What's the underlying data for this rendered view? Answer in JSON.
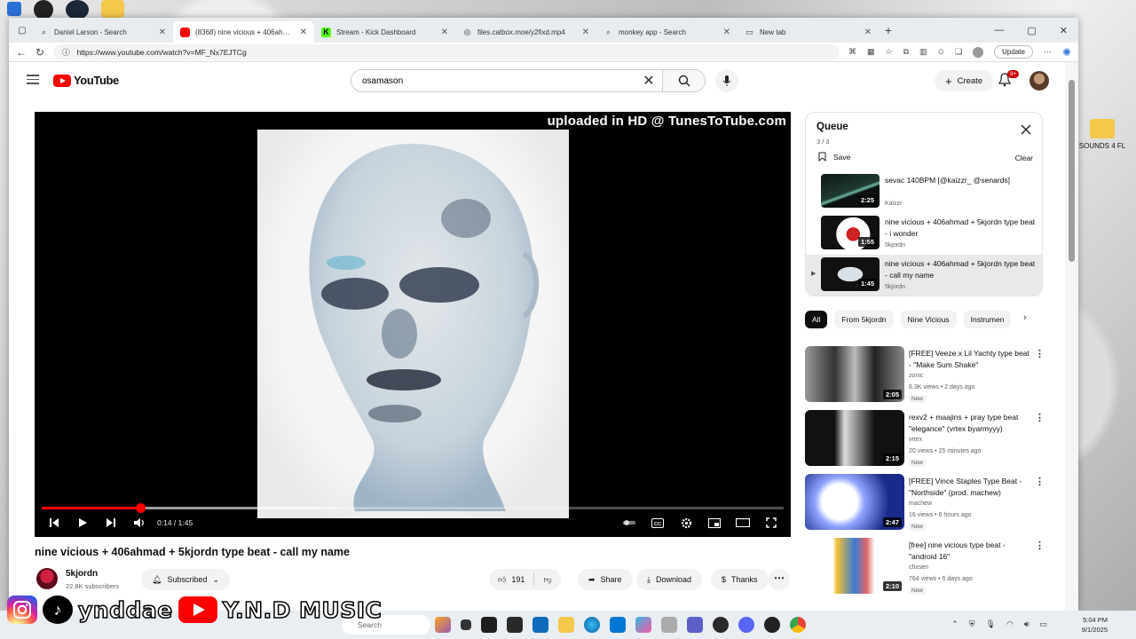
{
  "desktop": {
    "folder_label": "SOUNDS 4 FL"
  },
  "browser": {
    "tabs": [
      {
        "label": "Daniel Larson - Search",
        "icon": "search-icon"
      },
      {
        "label": "(8368) nine vicious + 406ahmad",
        "icon": "youtube-icon",
        "active": true
      },
      {
        "label": "Stream - Kick Dashboard",
        "icon": "kick-icon"
      },
      {
        "label": "files.catbox.moe/y2fixd.mp4",
        "icon": "globe-icon"
      },
      {
        "label": "monkey app - Search",
        "icon": "search-icon"
      },
      {
        "label": "New tab",
        "icon": "page-icon"
      }
    ],
    "url": "https://www.youtube.com/watch?v=MF_Nx7EJTCg",
    "update_label": "Update"
  },
  "youtube": {
    "logo_text": "YouTube",
    "search_value": "osamason",
    "create_label": "Create",
    "notification_badge": "9+",
    "player": {
      "watermark": "uploaded in HD @ TunesToTube.com",
      "time_current": "0:14",
      "time_total": "1:45",
      "progress_fraction": 0.133,
      "buffered_fraction": 0.4
    },
    "video": {
      "title": "nine vicious + 406ahmad + 5kjordn type beat - call my name",
      "channel": "5kjordn",
      "subscribers": "22.8K subscribers",
      "subscribed_label": "Subscribed",
      "likes": "191",
      "share_label": "Share",
      "download_label": "Download",
      "thanks_label": "Thanks"
    },
    "queue": {
      "title": "Queue",
      "count": "3 / 3",
      "save_label": "Save",
      "clear_label": "Clear",
      "items": [
        {
          "title": "sevac 140BPM [@kaizzr_ @senards]",
          "channel": "Kaizzr",
          "duration": "2:25"
        },
        {
          "title": "nine vicious + 406ahmad + 5kjordn type beat - i wonder",
          "channel": "5kjordn",
          "duration": "1:55"
        },
        {
          "title": "nine vicious + 406ahmad + 5kjordn type beat - call my name",
          "channel": "5kjordn",
          "duration": "1:45"
        }
      ]
    },
    "chips": [
      "All",
      "From 5kjordn",
      "Nine Vicious",
      "Instrumen"
    ],
    "recommendations": [
      {
        "title": "[FREE] Veeze x Lil Yachty type beat - \"Make Sum Shake\"",
        "channel": "zonic",
        "meta": "6.3K views • 2 days ago",
        "badge": "New",
        "duration": "2:05"
      },
      {
        "title": "rexv2 + maajins + pray type beat \"elegance\" (vrtex byarmyyy)",
        "channel": "vrtex",
        "meta": "20 views • 25 minutes ago",
        "badge": "New",
        "duration": "2:15"
      },
      {
        "title": "[FREE] Vince Staples Type Beat - \"Northside\" (prod. machew)",
        "channel": "machew",
        "meta": "16 views • 6 hours ago",
        "badge": "New",
        "duration": "2:47"
      },
      {
        "title": "[free] nine vicious type beat - \"android 16\"",
        "channel": "chxsen",
        "meta": "764 views • 6 days ago",
        "badge": "New",
        "duration": "2:10"
      }
    ]
  },
  "taskbar": {
    "search_placeholder": "Search",
    "time": "5:04 PM",
    "date": "9/1/2025"
  },
  "overlay": {
    "handle": "ynddae",
    "channel_name": "Y.N.D MUSIC"
  }
}
